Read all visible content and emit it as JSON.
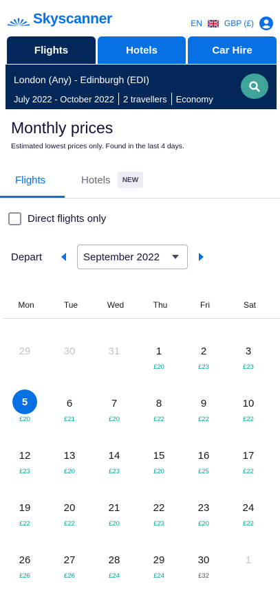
{
  "brand": {
    "name": "Skyscanner"
  },
  "header": {
    "language": "EN",
    "currency": "GBP (£)",
    "flag_icon": "uk-flag-icon",
    "account_icon": "account-icon"
  },
  "nav_tabs": [
    {
      "label": "Flights",
      "active": true
    },
    {
      "label": "Hotels",
      "active": false
    },
    {
      "label": "Car Hire",
      "active": false
    }
  ],
  "search": {
    "route": "London (Any) - Edinburgh (EDI)",
    "dates": "July 2022 - October 2022",
    "travellers": "2 travellers",
    "cabin": "Economy",
    "button_icon": "search-icon"
  },
  "page": {
    "title": "Monthly prices",
    "subtitle": "Estimated lowest prices only. Found in the last 4 days."
  },
  "price_tabs": {
    "flights": "Flights",
    "hotels": "Hotels",
    "hotels_badge": "NEW",
    "active": "flights"
  },
  "filters": {
    "direct_only_label": "Direct flights only",
    "direct_only_checked": false
  },
  "month_picker": {
    "label": "Depart",
    "selected": "September 2022"
  },
  "calendar": {
    "weekdays": [
      "Mon",
      "Tue",
      "Wed",
      "Thu",
      "Fri",
      "Sat"
    ],
    "weeks": [
      [
        {
          "day": "29",
          "price": "",
          "muted": true
        },
        {
          "day": "30",
          "price": "",
          "muted": true
        },
        {
          "day": "31",
          "price": "",
          "muted": true
        },
        {
          "day": "1",
          "price": "£20"
        },
        {
          "day": "2",
          "price": "£23"
        },
        {
          "day": "3",
          "price": "£23"
        }
      ],
      [
        {
          "day": "5",
          "price": "£20",
          "selected": true
        },
        {
          "day": "6",
          "price": "£21"
        },
        {
          "day": "7",
          "price": "£20"
        },
        {
          "day": "8",
          "price": "£22"
        },
        {
          "day": "9",
          "price": "£22"
        },
        {
          "day": "10",
          "price": "£22"
        }
      ],
      [
        {
          "day": "12",
          "price": "£23"
        },
        {
          "day": "13",
          "price": "£20"
        },
        {
          "day": "14",
          "price": "£23"
        },
        {
          "day": "15",
          "price": "£20"
        },
        {
          "day": "16",
          "price": "£25"
        },
        {
          "day": "17",
          "price": "£22"
        }
      ],
      [
        {
          "day": "19",
          "price": "£22"
        },
        {
          "day": "20",
          "price": "£22"
        },
        {
          "day": "21",
          "price": "£20"
        },
        {
          "day": "22",
          "price": "£23"
        },
        {
          "day": "23",
          "price": "£20"
        },
        {
          "day": "24",
          "price": "£22"
        }
      ],
      [
        {
          "day": "26",
          "price": "£26"
        },
        {
          "day": "27",
          "price": "£26"
        },
        {
          "day": "28",
          "price": "£24"
        },
        {
          "day": "29",
          "price": "£24"
        },
        {
          "day": "30",
          "price": "£32",
          "grey_price": true
        },
        {
          "day": "1",
          "price": "",
          "muted": true
        }
      ]
    ]
  },
  "colors": {
    "brand_blue": "#0770e3",
    "navy": "#042759",
    "search_button": "#3fa59a",
    "price_green": "#00a698"
  }
}
